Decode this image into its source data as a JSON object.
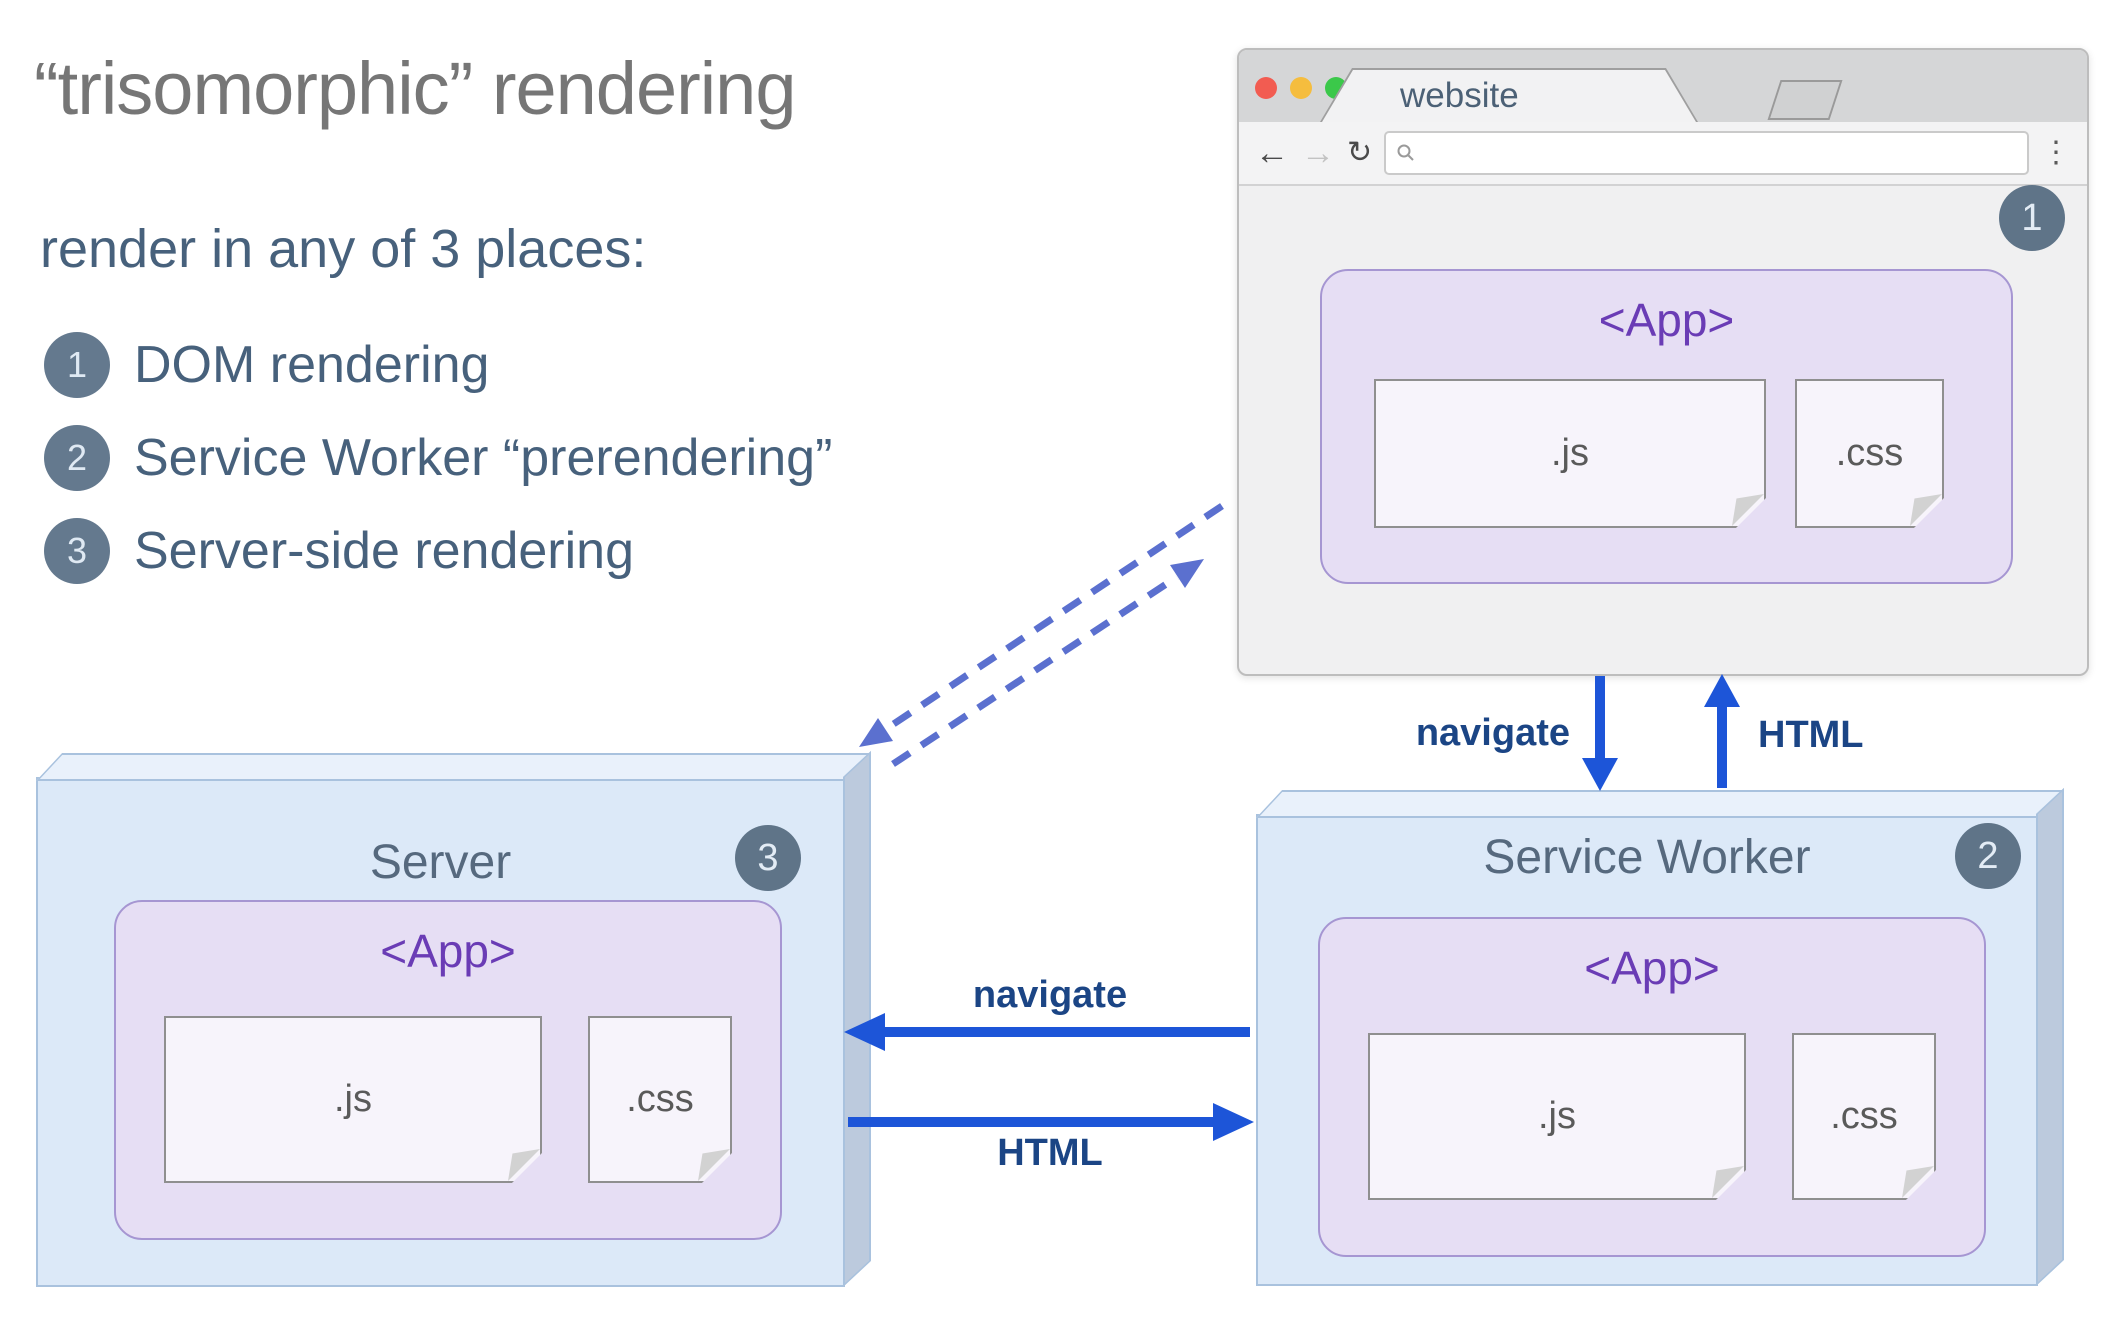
{
  "title": "“trisomorphic” rendering",
  "subtitle": "render in any of 3 places:",
  "list": [
    {
      "num": "1",
      "label": "DOM rendering"
    },
    {
      "num": "2",
      "label": "Service Worker “prerendering”"
    },
    {
      "num": "3",
      "label": "Server-side rendering"
    }
  ],
  "browser": {
    "tab_title": "website",
    "badge": "1",
    "url_value": "",
    "app": {
      "label": "<App>",
      "js": ".js",
      "css": ".css"
    }
  },
  "server": {
    "title": "Server",
    "badge": "3",
    "app": {
      "label": "<App>",
      "js": ".js",
      "css": ".css"
    }
  },
  "service_worker": {
    "title": "Service Worker",
    "badge": "2",
    "app": {
      "label": "<App>",
      "js": ".js",
      "css": ".css"
    }
  },
  "arrows": {
    "browser_sw_down": "navigate",
    "browser_sw_up": "HTML",
    "sw_server_left": "navigate",
    "sw_server_right": "HTML"
  },
  "colors": {
    "arrow_blue": "#1d55d8",
    "arrow_label_navy": "#1b4585",
    "dashed_periwinkle": "#5b70cf",
    "badge_slate": "#64798e",
    "slate_text": "#47617c",
    "title_gray": "#767676",
    "app_purple": "#6a3cb5",
    "box_blue_fill": "#dce9f8",
    "app_box_fill": "#e6def4"
  }
}
